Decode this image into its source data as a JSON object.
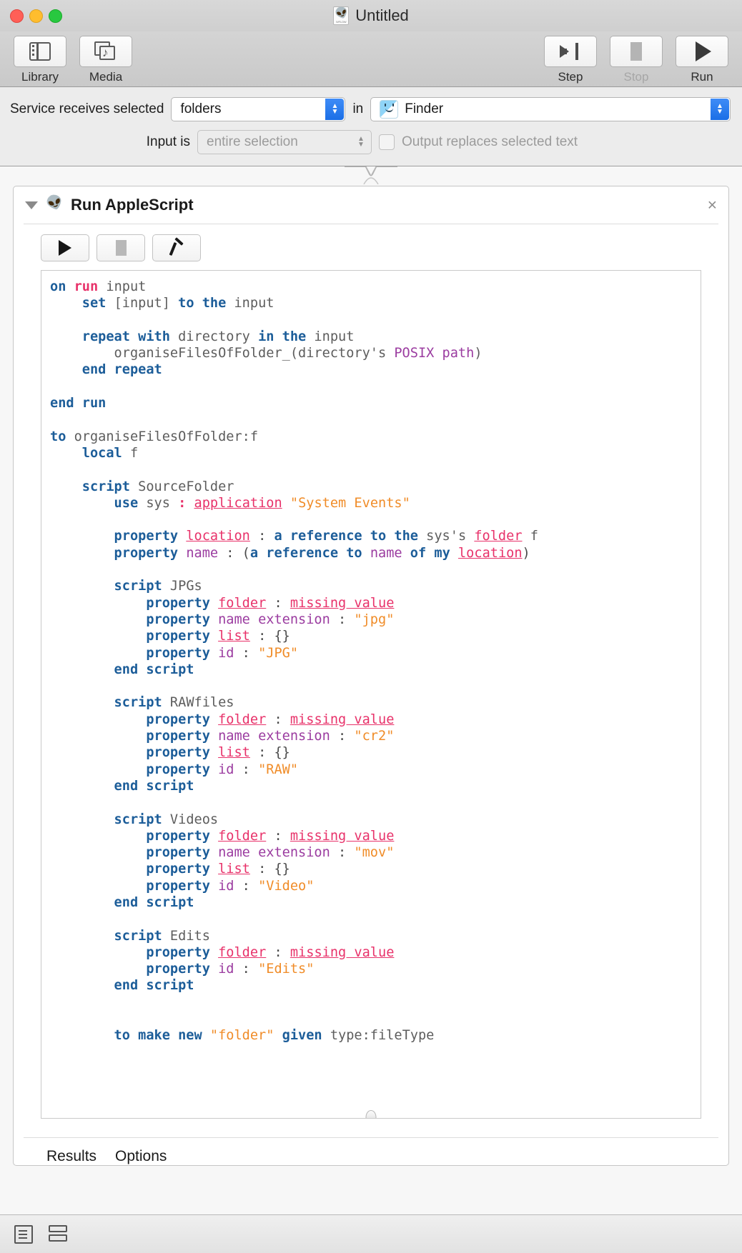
{
  "window": {
    "title": "Untitled",
    "doc_icon": "automator-workflow-icon",
    "doc_icon_caption": "WFLOW"
  },
  "toolbar": {
    "left_items": [
      {
        "label": "Library",
        "icon": "library-panel-icon"
      },
      {
        "label": "Media",
        "icon": "media-browser-icon"
      }
    ],
    "right_items": [
      {
        "label": "Step",
        "icon": "step-arrow-icon",
        "enabled": true
      },
      {
        "label": "Stop",
        "icon": "stop-square-icon",
        "enabled": false
      },
      {
        "label": "Run",
        "icon": "play-triangle-icon",
        "enabled": true
      }
    ]
  },
  "service_config": {
    "receives_label": "Service receives selected",
    "receives_value": "folders",
    "in_label": "in",
    "app_value": "Finder",
    "app_icon": "finder-icon",
    "input_is_label": "Input is",
    "input_is_value": "entire selection",
    "output_checkbox_label": "Output replaces selected text",
    "output_checked": false
  },
  "action": {
    "title": "Run AppleScript",
    "icon": "applescript-icon",
    "close_glyph": "×",
    "disclosure_state": "expanded",
    "script_buttons": [
      {
        "name": "run-script",
        "icon": "play-triangle-icon"
      },
      {
        "name": "stop-script",
        "icon": "stop-square-icon"
      },
      {
        "name": "compile-script",
        "icon": "hammer-icon"
      }
    ],
    "tabs": [
      {
        "label": "Results"
      },
      {
        "label": "Options"
      }
    ]
  },
  "code": {
    "language": "AppleScript",
    "lines": [
      [
        {
          "t": "on ",
          "c": "k"
        },
        {
          "t": "run",
          "c": "r"
        },
        {
          "t": " input",
          "c": "n"
        }
      ],
      [
        {
          "t": "    set ",
          "c": "k"
        },
        {
          "t": "[input] ",
          "c": "n"
        },
        {
          "t": "to the",
          "c": "k"
        },
        {
          "t": " input",
          "c": "n"
        }
      ],
      [],
      [
        {
          "t": "    repeat with",
          "c": "k"
        },
        {
          "t": " directory ",
          "c": "n"
        },
        {
          "t": "in the",
          "c": "k"
        },
        {
          "t": " input",
          "c": "n"
        }
      ],
      [
        {
          "t": "        organiseFilesOfFolder_(directory's ",
          "c": "n"
        },
        {
          "t": "POSIX path",
          "c": "pu"
        },
        {
          "t": ")",
          "c": "n"
        }
      ],
      [
        {
          "t": "    end repeat",
          "c": "k"
        }
      ],
      [],
      [
        {
          "t": "end run",
          "c": "k"
        }
      ],
      [],
      [
        {
          "t": "to",
          "c": "k"
        },
        {
          "t": " organiseFilesOfFolder:f",
          "c": "n"
        }
      ],
      [
        {
          "t": "    local",
          "c": "k"
        },
        {
          "t": " f",
          "c": "n"
        }
      ],
      [],
      [
        {
          "t": "    script",
          "c": "k"
        },
        {
          "t": " SourceFolder",
          "c": "n"
        }
      ],
      [
        {
          "t": "        use",
          "c": "k"
        },
        {
          "t": " sys ",
          "c": "n"
        },
        {
          "t": ":",
          "c": "r"
        },
        {
          "t": " ",
          "c": "n"
        },
        {
          "t": "application",
          "c": "pl"
        },
        {
          "t": " ",
          "c": "n"
        },
        {
          "t": "\"System Events\"",
          "c": "s"
        }
      ],
      [],
      [
        {
          "t": "        property ",
          "c": "k"
        },
        {
          "t": "location",
          "c": "pl"
        },
        {
          "t": " : ",
          "c": "p"
        },
        {
          "t": "a reference to the",
          "c": "k"
        },
        {
          "t": " sys's ",
          "c": "n"
        },
        {
          "t": "folder",
          "c": "pl"
        },
        {
          "t": " f",
          "c": "n"
        }
      ],
      [
        {
          "t": "        property ",
          "c": "k"
        },
        {
          "t": "name",
          "c": "pu"
        },
        {
          "t": " : (",
          "c": "p"
        },
        {
          "t": "a reference to",
          "c": "k"
        },
        {
          "t": " ",
          "c": "n"
        },
        {
          "t": "name",
          "c": "pu"
        },
        {
          "t": " ",
          "c": "n"
        },
        {
          "t": "of my",
          "c": "k"
        },
        {
          "t": " ",
          "c": "n"
        },
        {
          "t": "location",
          "c": "pl"
        },
        {
          "t": ")",
          "c": "p"
        }
      ],
      [],
      [
        {
          "t": "        script",
          "c": "k"
        },
        {
          "t": " JPGs",
          "c": "n"
        }
      ],
      [
        {
          "t": "            property ",
          "c": "k"
        },
        {
          "t": "folder",
          "c": "pl"
        },
        {
          "t": " : ",
          "c": "p"
        },
        {
          "t": "missing value",
          "c": "pl"
        }
      ],
      [
        {
          "t": "            property ",
          "c": "k"
        },
        {
          "t": "name extension",
          "c": "pu"
        },
        {
          "t": " : ",
          "c": "p"
        },
        {
          "t": "\"jpg\"",
          "c": "s"
        }
      ],
      [
        {
          "t": "            property ",
          "c": "k"
        },
        {
          "t": "list",
          "c": "pl"
        },
        {
          "t": " : {}",
          "c": "p"
        }
      ],
      [
        {
          "t": "            property ",
          "c": "k"
        },
        {
          "t": "id",
          "c": "pu"
        },
        {
          "t": " : ",
          "c": "p"
        },
        {
          "t": "\"JPG\"",
          "c": "s"
        }
      ],
      [
        {
          "t": "        end script",
          "c": "k"
        }
      ],
      [],
      [
        {
          "t": "        script",
          "c": "k"
        },
        {
          "t": " RAWfiles",
          "c": "n"
        }
      ],
      [
        {
          "t": "            property ",
          "c": "k"
        },
        {
          "t": "folder",
          "c": "pl"
        },
        {
          "t": " : ",
          "c": "p"
        },
        {
          "t": "missing value",
          "c": "pl"
        }
      ],
      [
        {
          "t": "            property ",
          "c": "k"
        },
        {
          "t": "name extension",
          "c": "pu"
        },
        {
          "t": " : ",
          "c": "p"
        },
        {
          "t": "\"cr2\"",
          "c": "s"
        }
      ],
      [
        {
          "t": "            property ",
          "c": "k"
        },
        {
          "t": "list",
          "c": "pl"
        },
        {
          "t": " : {}",
          "c": "p"
        }
      ],
      [
        {
          "t": "            property ",
          "c": "k"
        },
        {
          "t": "id",
          "c": "pu"
        },
        {
          "t": " : ",
          "c": "p"
        },
        {
          "t": "\"RAW\"",
          "c": "s"
        }
      ],
      [
        {
          "t": "        end script",
          "c": "k"
        }
      ],
      [],
      [
        {
          "t": "        script",
          "c": "k"
        },
        {
          "t": " Videos",
          "c": "n"
        }
      ],
      [
        {
          "t": "            property ",
          "c": "k"
        },
        {
          "t": "folder",
          "c": "pl"
        },
        {
          "t": " : ",
          "c": "p"
        },
        {
          "t": "missing value",
          "c": "pl"
        }
      ],
      [
        {
          "t": "            property ",
          "c": "k"
        },
        {
          "t": "name extension",
          "c": "pu"
        },
        {
          "t": " : ",
          "c": "p"
        },
        {
          "t": "\"mov\"",
          "c": "s"
        }
      ],
      [
        {
          "t": "            property ",
          "c": "k"
        },
        {
          "t": "list",
          "c": "pl"
        },
        {
          "t": " : {}",
          "c": "p"
        }
      ],
      [
        {
          "t": "            property ",
          "c": "k"
        },
        {
          "t": "id",
          "c": "pu"
        },
        {
          "t": " : ",
          "c": "p"
        },
        {
          "t": "\"Video\"",
          "c": "s"
        }
      ],
      [
        {
          "t": "        end script",
          "c": "k"
        }
      ],
      [],
      [
        {
          "t": "        script",
          "c": "k"
        },
        {
          "t": " Edits",
          "c": "n"
        }
      ],
      [
        {
          "t": "            property ",
          "c": "k"
        },
        {
          "t": "folder",
          "c": "pl"
        },
        {
          "t": " : ",
          "c": "p"
        },
        {
          "t": "missing value",
          "c": "pl"
        }
      ],
      [
        {
          "t": "            property ",
          "c": "k"
        },
        {
          "t": "id",
          "c": "pu"
        },
        {
          "t": " : ",
          "c": "p"
        },
        {
          "t": "\"Edits\"",
          "c": "s"
        }
      ],
      [
        {
          "t": "        end script",
          "c": "k"
        }
      ],
      [],
      [],
      [
        {
          "t": "        to make new ",
          "c": "k"
        },
        {
          "t": "\"folder\"",
          "c": "s"
        },
        {
          "t": " given",
          "c": "k"
        },
        {
          "t": " type:fileType",
          "c": "n"
        }
      ]
    ]
  },
  "statusbar": {
    "icons": [
      {
        "name": "log-view-icon"
      },
      {
        "name": "split-view-icon"
      }
    ]
  }
}
